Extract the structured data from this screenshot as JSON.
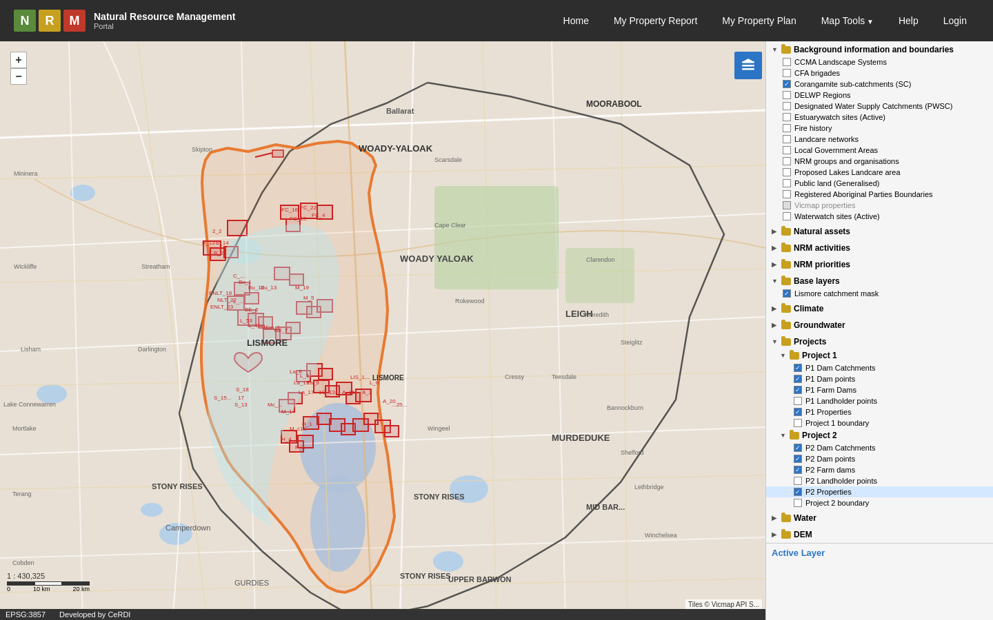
{
  "header": {
    "logo": {
      "letters": [
        {
          "char": "N",
          "class": "logo-n"
        },
        {
          "char": "R",
          "class": "logo-r"
        },
        {
          "char": "M",
          "class": "logo-m"
        }
      ],
      "title": "Natural Resource Management",
      "subtitle": "Portal"
    },
    "nav": [
      {
        "label": "Home",
        "id": "home"
      },
      {
        "label": "My Property Report",
        "id": "property-report"
      },
      {
        "label": "My Property Plan",
        "id": "property-plan"
      },
      {
        "label": "Map Tools",
        "id": "map-tools",
        "dropdown": true
      },
      {
        "label": "Help",
        "id": "help"
      },
      {
        "label": "Login",
        "id": "login"
      }
    ]
  },
  "map": {
    "scale": "1 : 430,325",
    "scale_labels": [
      "0",
      "10 km",
      "20 km"
    ],
    "attribution": "Tiles © Vicmap API S...",
    "epsg": "EPSG:3857",
    "credit": "Developed by CeRDI"
  },
  "layers": {
    "active_layer_label": "Active Layer",
    "groups": [
      {
        "id": "background",
        "label": "Background information and boundaries",
        "expanded": true,
        "type": "folder",
        "items": [
          {
            "label": "CCMA Landscape Systems",
            "checked": false
          },
          {
            "label": "CFA brigades",
            "checked": false
          },
          {
            "label": "Corangamite sub-catchments (SC)",
            "checked": true
          },
          {
            "label": "DELWP Regions",
            "checked": false
          },
          {
            "label": "Designated Water Supply Catchments (PWSC)",
            "checked": false
          },
          {
            "label": "Estuarywatch sites (Active)",
            "checked": false
          },
          {
            "label": "Fire history",
            "checked": false
          },
          {
            "label": "Landcare networks",
            "checked": false
          },
          {
            "label": "Local Government Areas",
            "checked": false
          },
          {
            "label": "NRM groups and organisations",
            "checked": false
          },
          {
            "label": "Proposed Lakes Landcare area",
            "checked": false
          },
          {
            "label": "Public land (Generalised)",
            "checked": false
          },
          {
            "label": "Registered Aboriginal Parties Boundaries",
            "checked": false
          },
          {
            "label": "Vicmap properties",
            "checked": false
          },
          {
            "label": "Waterwatch sites (Active)",
            "checked": false
          }
        ]
      },
      {
        "id": "natural-assets",
        "label": "Natural assets",
        "expanded": false,
        "type": "folder",
        "items": []
      },
      {
        "id": "nrm-activities",
        "label": "NRM activities",
        "expanded": false,
        "type": "folder",
        "items": []
      },
      {
        "id": "nrm-priorities",
        "label": "NRM priorities",
        "expanded": false,
        "type": "folder",
        "items": []
      },
      {
        "id": "base-layers",
        "label": "Base layers",
        "expanded": true,
        "type": "folder",
        "items": [
          {
            "label": "Lismore catchment mask",
            "checked": true
          }
        ]
      },
      {
        "id": "climate",
        "label": "Climate",
        "expanded": false,
        "type": "folder",
        "items": []
      },
      {
        "id": "groundwater",
        "label": "Groundwater",
        "expanded": false,
        "type": "folder",
        "items": []
      },
      {
        "id": "projects",
        "label": "Projects",
        "expanded": true,
        "type": "folder",
        "subgroups": [
          {
            "id": "project1",
            "label": "Project 1",
            "expanded": true,
            "items": [
              {
                "label": "P1 Dam Catchments",
                "checked": true
              },
              {
                "label": "P1 Dam points",
                "checked": true
              },
              {
                "label": "P1 Farm Dams",
                "checked": true
              },
              {
                "label": "P1 Landholder points",
                "checked": false
              },
              {
                "label": "P1 Properties",
                "checked": true
              },
              {
                "label": "Project 1 boundary",
                "checked": false
              }
            ]
          },
          {
            "id": "project2",
            "label": "Project 2",
            "expanded": true,
            "items": [
              {
                "label": "P2 Dam Catchments",
                "checked": true
              },
              {
                "label": "P2 Dam points",
                "checked": true
              },
              {
                "label": "P2 Farm dams",
                "checked": true
              },
              {
                "label": "P2 Landholder points",
                "checked": false
              },
              {
                "label": "P2 Properties",
                "checked": true,
                "highlighted": true
              },
              {
                "label": "Project 2 boundary",
                "checked": false
              }
            ]
          }
        ]
      },
      {
        "id": "water",
        "label": "Water",
        "expanded": false,
        "type": "folder",
        "items": []
      },
      {
        "id": "dem",
        "label": "DEM",
        "expanded": false,
        "type": "folder",
        "items": []
      }
    ]
  },
  "zoom": {
    "plus": "+",
    "minus": "−"
  }
}
